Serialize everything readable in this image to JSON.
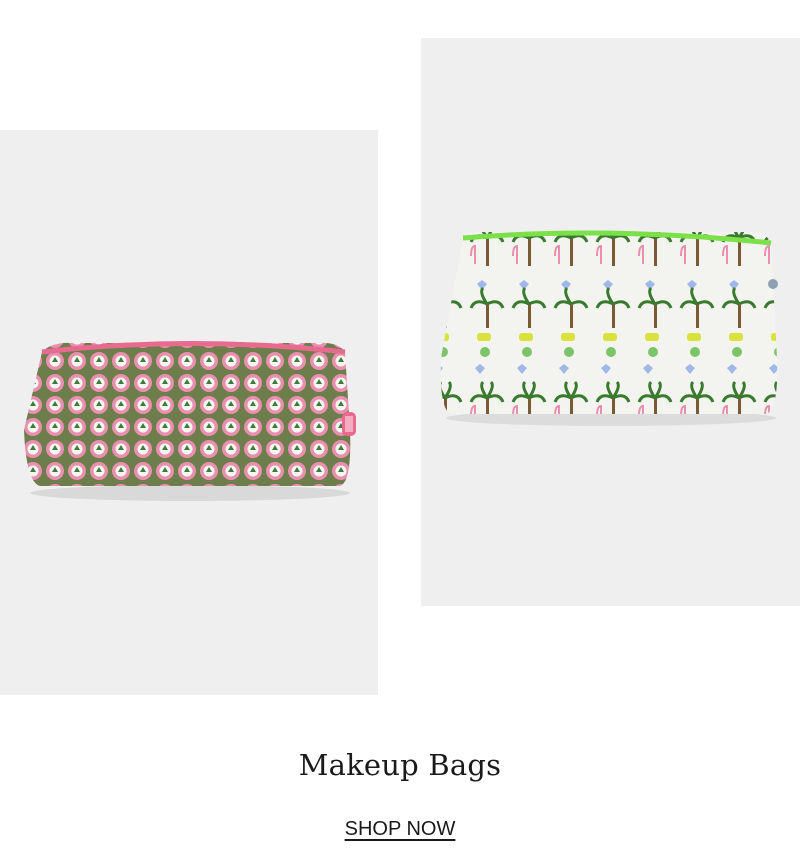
{
  "section": {
    "title": "Makeup Bags",
    "cta_label": "SHOP NOW"
  },
  "products": [
    {
      "name": "pink-green-floral-makeup-bag",
      "zipper_color": "#e86a8f",
      "pattern_colors": [
        "#e98fb0",
        "#3f7b3f",
        "#ffffff"
      ]
    },
    {
      "name": "palm-elephant-flamingo-makeup-bag",
      "zipper_color": "#7be04a",
      "pattern_colors": [
        "#3a7a2f",
        "#9fb8e8",
        "#d9e23a",
        "#e98fb0"
      ]
    }
  ],
  "colors": {
    "panel_bg": "#efefef",
    "text": "#1a1a1a"
  }
}
